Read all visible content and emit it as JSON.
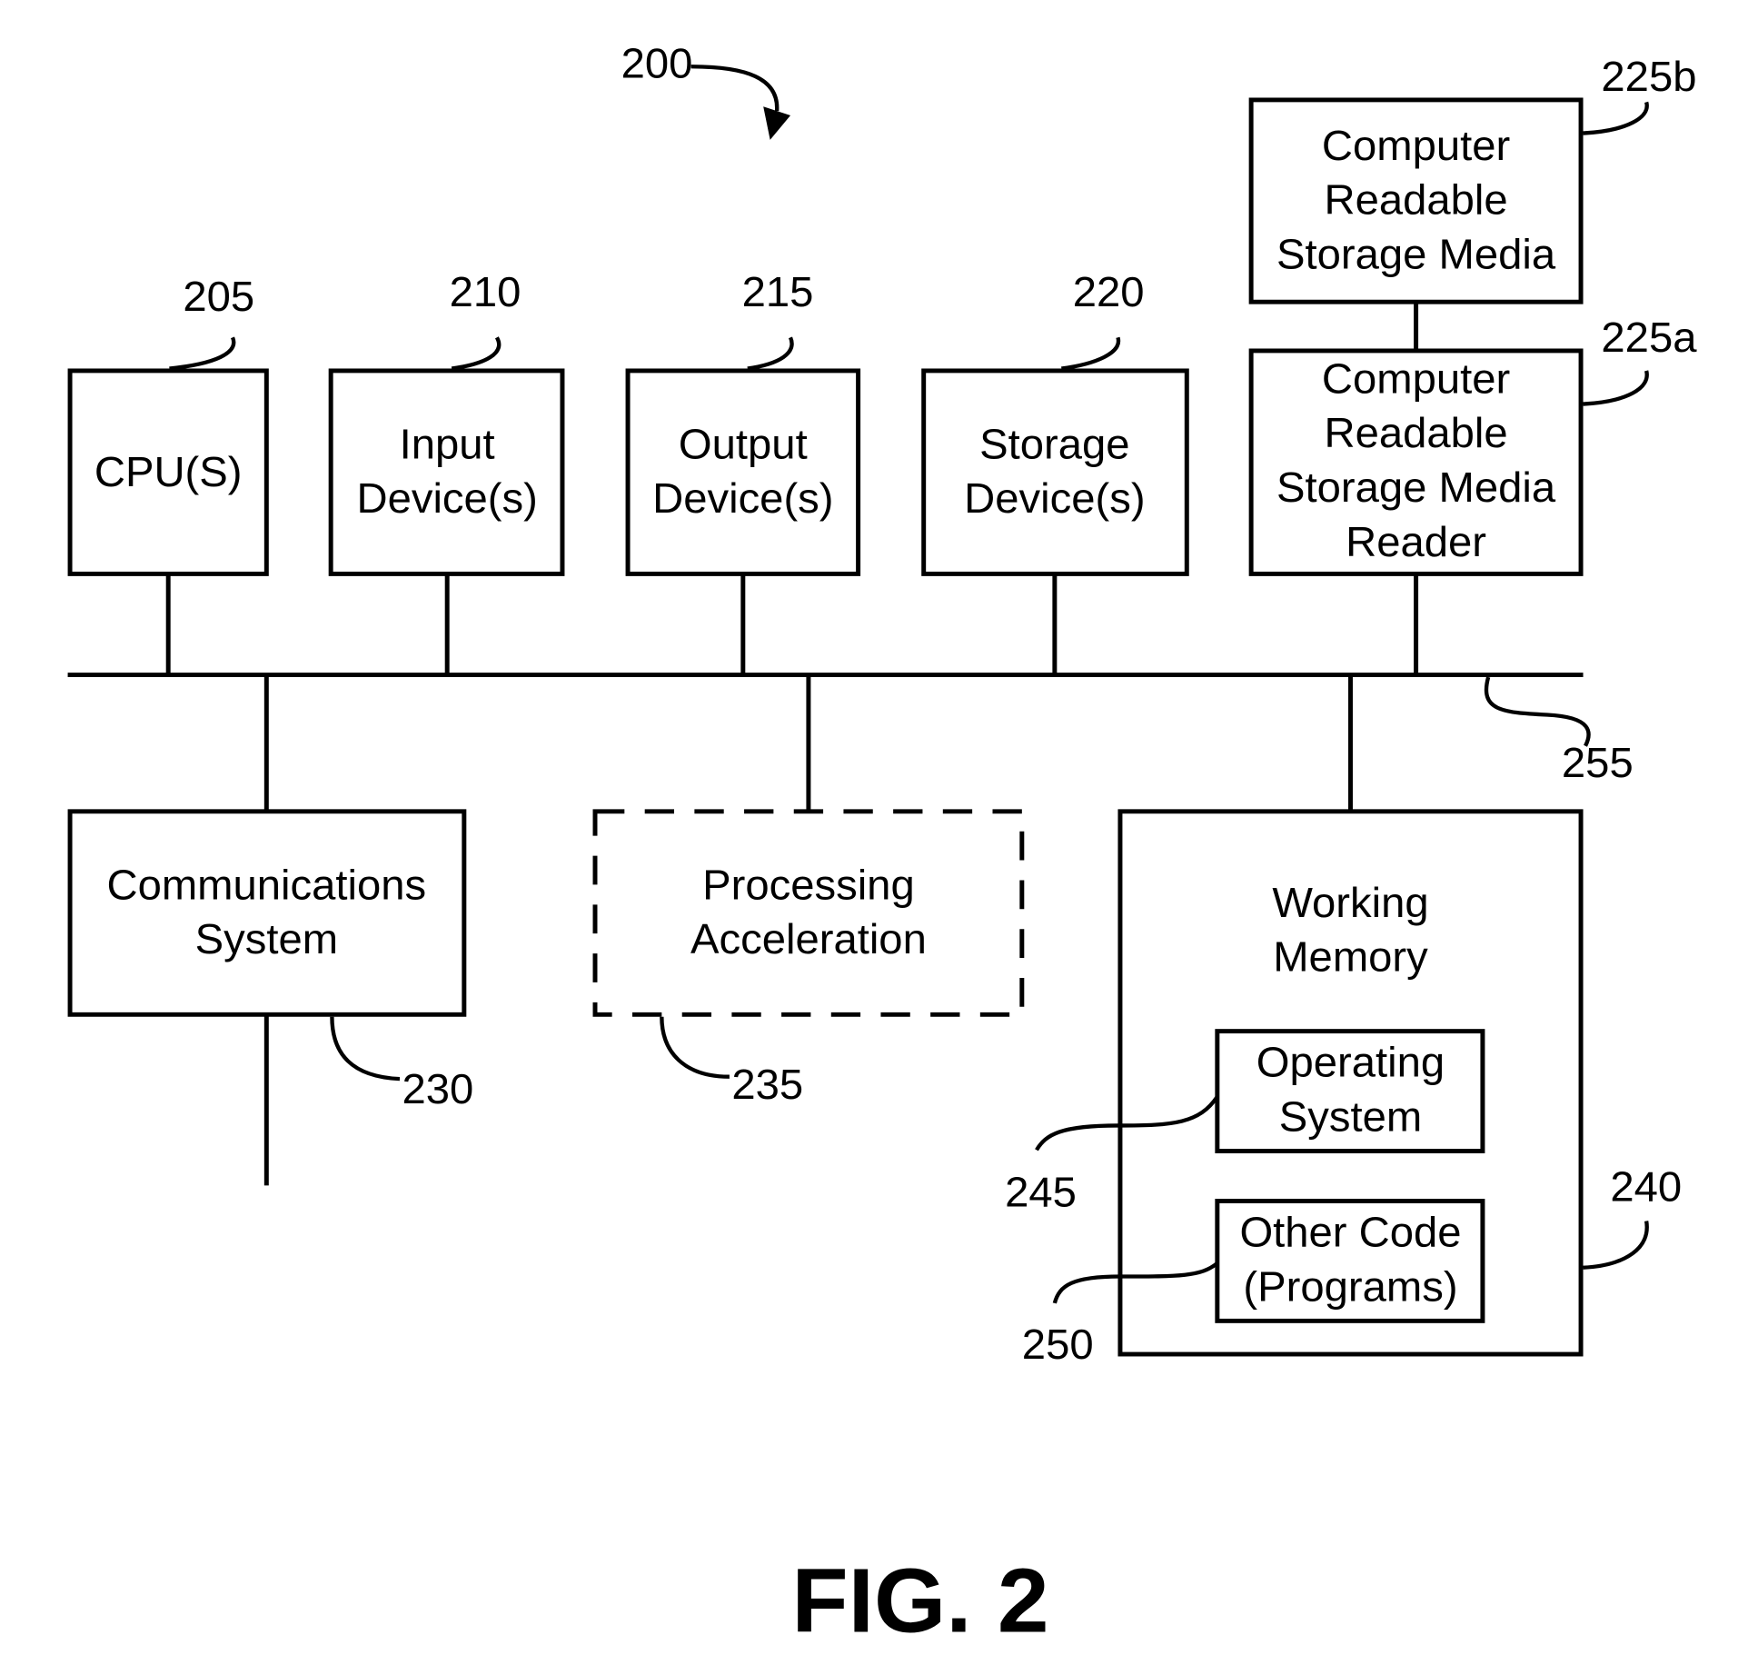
{
  "figure": {
    "number_ref": "200",
    "caption": "FIG. 2",
    "bus_ref": "255"
  },
  "boxes": {
    "cpu": {
      "lines": [
        "CPU(S)"
      ],
      "ref": "205"
    },
    "input": {
      "lines": [
        "Input",
        "Device(s)"
      ],
      "ref": "210"
    },
    "output": {
      "lines": [
        "Output",
        "Device(s)"
      ],
      "ref": "215"
    },
    "storage": {
      "lines": [
        "Storage",
        "Device(s)"
      ],
      "ref": "220"
    },
    "crsm": {
      "lines": [
        "Computer",
        "Readable",
        "Storage Media"
      ],
      "ref": "225b"
    },
    "crsm_reader": {
      "lines": [
        "Computer",
        "Readable",
        "Storage Media",
        "Reader"
      ],
      "ref": "225a"
    },
    "comms": {
      "lines": [
        "Communications",
        "System"
      ],
      "ref": "230"
    },
    "accel": {
      "lines": [
        "Processing",
        "Acceleration"
      ],
      "ref": "235",
      "optional": true
    },
    "working_memory": {
      "lines": [
        "Working",
        "Memory"
      ],
      "ref": "240"
    },
    "os": {
      "lines": [
        "Operating",
        "System"
      ],
      "ref": "245"
    },
    "other_code": {
      "lines": [
        "Other Code",
        "(Programs)"
      ],
      "ref": "250"
    }
  }
}
